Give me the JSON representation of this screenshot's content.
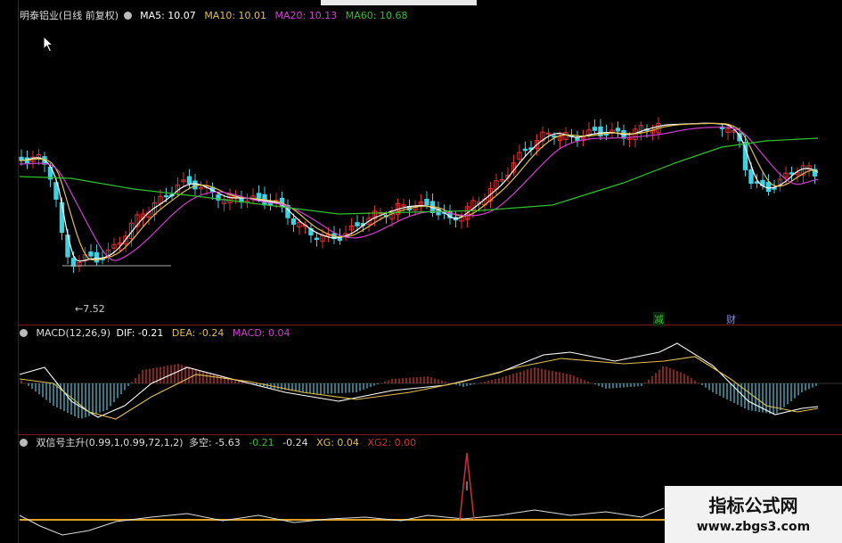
{
  "main_legend": {
    "title": "明泰铝业(日线 前复权)",
    "ma5": "MA5: 10.07",
    "ma10": "MA10: 10.01",
    "ma20": "MA20: 10.13",
    "ma60": "MA60: 10.68",
    "colors": {
      "ma5": "#ffffff",
      "ma10": "#e0c050",
      "ma20": "#d040d0",
      "ma60": "#30c030"
    }
  },
  "low_marker": "←7.52",
  "event_tags": {
    "tag1": "减",
    "tag2": "财"
  },
  "macd_legend": {
    "title": "MACD(12,26,9)",
    "dif": "DIF: -0.21",
    "dea": "DEA: -0.24",
    "macd": "MACD: 0.04"
  },
  "signal_legend": {
    "title": "双信号主升(0.99,1,0.99,72,1,2)",
    "duokong": "多空: -5.63",
    "v1": "-0.21",
    "v2": "-0.24",
    "xg": "XG: 0.04",
    "xg2": "XG2: 0.00"
  },
  "watermark": {
    "line1": "指标公式网",
    "line2": "www.zbgs3.com"
  },
  "chart_data": {
    "type": "candlestick",
    "title": "明泰铝业(日线 前复权)",
    "annotated_low": 7.52,
    "ma_latest": {
      "MA5": 10.07,
      "MA10": 10.01,
      "MA20": 10.13,
      "MA60": 10.68
    },
    "macd_latest": {
      "DIF": -0.21,
      "DEA": -0.24,
      "MACD": 0.04
    },
    "signal_latest": {
      "多空": -5.63,
      "XG": 0.04,
      "XG2": 0.0
    }
  }
}
